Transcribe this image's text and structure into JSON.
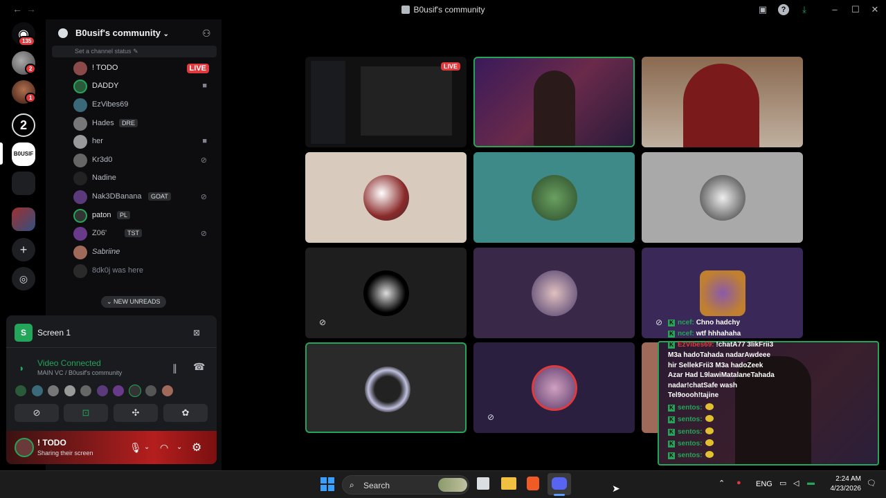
{
  "window": {
    "title": "B0usif's community"
  },
  "rail": {
    "notif_count": "135",
    "srv1_badge": "2",
    "srv2_badge": "1",
    "srv3_label": "2",
    "srv_selected_label": "B0USIF"
  },
  "panel": {
    "server_name": "B0usif's community",
    "status_placeholder": "Set a channel status",
    "members": [
      {
        "name": "! TODO",
        "badge": "LIVE"
      },
      {
        "name": "DADDY"
      },
      {
        "name": "EzVibes69"
      },
      {
        "name": "Hades",
        "tag": "DRE"
      },
      {
        "name": "her"
      },
      {
        "name": "Kr3d0"
      },
      {
        "name": "Nadine"
      },
      {
        "name": "Nak3DBanana",
        "tag": "GOAT"
      },
      {
        "name": "paton",
        "tag": "PL"
      },
      {
        "name": "Z06'",
        "tag": "TST"
      },
      {
        "name": "Sabriine"
      },
      {
        "name": "8dk0j was here"
      }
    ],
    "new_unreads": "NEW UNREADS"
  },
  "voice": {
    "screen_title": "Screen 1",
    "connected": "Video Connected",
    "channel": "MAIN VC / B0usif's community",
    "user_name": "! TODO",
    "user_status": "Sharing their screen"
  },
  "stream": {
    "live_badge": "LIVE"
  },
  "chat": {
    "lines": [
      {
        "user": "ncef:",
        "text": "Chno hadchy"
      },
      {
        "user": "ncef:",
        "text": "wtf hhhahaha"
      },
      {
        "user": "EzVibes69:",
        "text": "!chatA77 3likFrii3"
      },
      {
        "user": "",
        "text": "M3a hadoTahada nadarAwdeee"
      },
      {
        "user": "",
        "text": "hir SellekFrii3 M3a hadoZeek"
      },
      {
        "user": "",
        "text": "Azar Had L9lawiMatalaneTahada"
      },
      {
        "user": "",
        "text": "nadar!chatSafe wash"
      },
      {
        "user": "",
        "text": "Tel9oooh!tajine"
      },
      {
        "user": "sentos:",
        "text": ""
      },
      {
        "user": "sentos:",
        "text": ""
      },
      {
        "user": "sentos:",
        "text": ""
      },
      {
        "user": "sentos:",
        "text": ""
      },
      {
        "user": "sentos:",
        "text": ""
      }
    ]
  },
  "taskbar": {
    "search": "Search",
    "lang": "ENG",
    "time": "2:24 AM",
    "date": "4/23/2026"
  }
}
